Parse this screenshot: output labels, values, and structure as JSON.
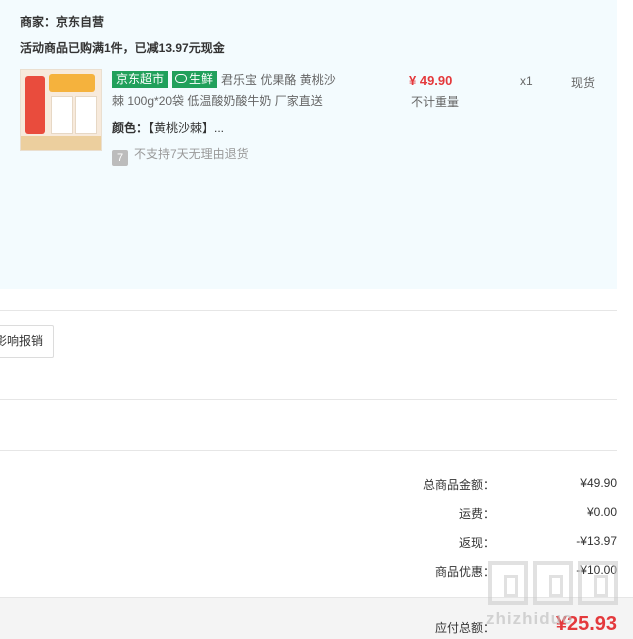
{
  "order": {
    "merchant": "商家：京东自营",
    "promo": "活动商品已购满1件，已减13.97元现金",
    "item": {
      "thumbnail_icon": "product-thumbnail",
      "tag_jd": "京东超市",
      "tag_fresh": "生鲜",
      "title_line1": "君乐宝 优果酪 黄桃沙",
      "title_line2": "棘 100g*20袋 低温酸奶酸牛奶 厂家直送",
      "color_label": "颜色：",
      "color_value": "【黄桃沙棘】...",
      "return_icon_text": "7",
      "return_text": "不支持7天无理由退货",
      "price": "¥ 49.90",
      "weight": "不计重量",
      "qty": "x1",
      "stock": "现货"
    }
  },
  "invoice": {
    "button_label": "影响报销"
  },
  "summary": {
    "rows": [
      {
        "label": "总商品金额：",
        "value": "¥49.90"
      },
      {
        "label": "运费：",
        "value": "¥0.00"
      },
      {
        "label": "返现：",
        "value": "-¥13.97"
      },
      {
        "label": "商品优惠：",
        "value": "-¥10.00"
      }
    ],
    "total_label": "应付总额：",
    "total_value": "¥25.93"
  },
  "watermark": {
    "text": "zhizhiduo"
  },
  "colors": {
    "accent_red": "#e4393c",
    "tag_green": "#21a05b",
    "panel_bg": "#f3fbfe"
  }
}
